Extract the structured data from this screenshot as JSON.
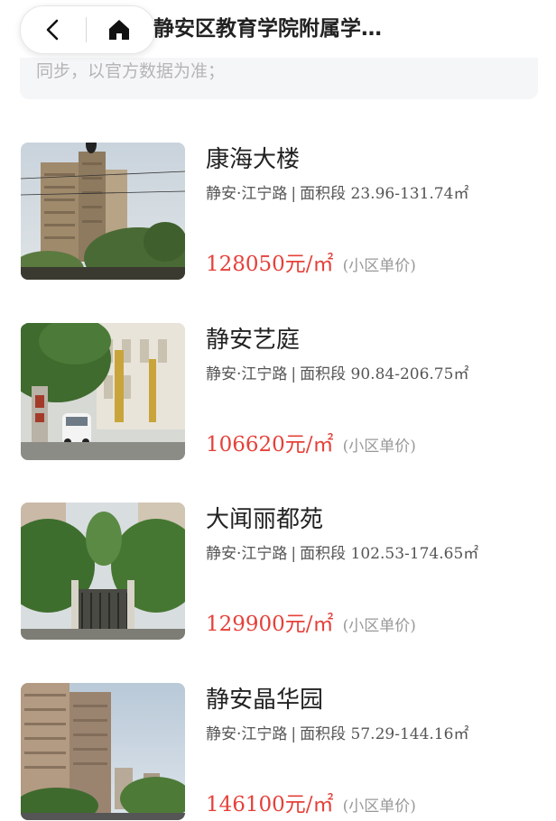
{
  "header": {
    "title": "静安区教育学院附属学…",
    "back_icon": "chevron-left-icon",
    "home_icon": "home-icon"
  },
  "notice": {
    "text": "同步，以官方数据为准；"
  },
  "listings": [
    {
      "name": "康海大楼",
      "district": "静安·江宁路",
      "separator": "|",
      "area_label": "面积段",
      "area_range": "23.96-131.74㎡",
      "price": "128050元/㎡",
      "price_note": "(小区单价)"
    },
    {
      "name": "静安艺庭",
      "district": "静安·江宁路",
      "separator": "|",
      "area_label": "面积段",
      "area_range": "90.84-206.75㎡",
      "price": "106620元/㎡",
      "price_note": "(小区单价)"
    },
    {
      "name": "大闻丽都苑",
      "district": "静安·江宁路",
      "separator": "|",
      "area_label": "面积段",
      "area_range": "102.53-174.65㎡",
      "price": "129900元/㎡",
      "price_note": "(小区单价)"
    },
    {
      "name": "静安晶华园",
      "district": "静安·江宁路",
      "separator": "|",
      "area_label": "面积段",
      "area_range": "57.29-144.16㎡",
      "price": "146100元/㎡",
      "price_note": "(小区单价)"
    }
  ],
  "colors": {
    "price": "#e5413a",
    "notice_bg": "#f5f6f8"
  }
}
